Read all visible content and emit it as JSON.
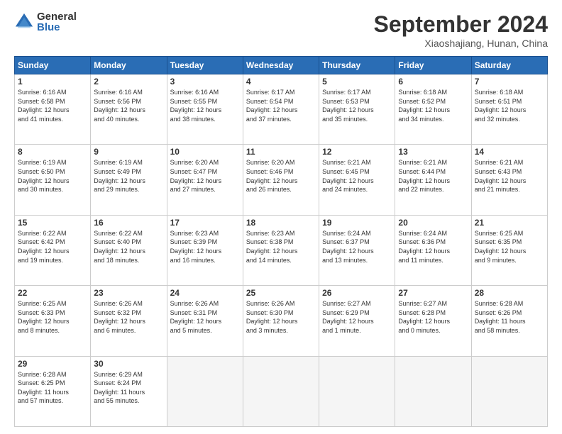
{
  "logo": {
    "general": "General",
    "blue": "Blue"
  },
  "title": "September 2024",
  "subtitle": "Xiaoshajiang, Hunan, China",
  "weekdays": [
    "Sunday",
    "Monday",
    "Tuesday",
    "Wednesday",
    "Thursday",
    "Friday",
    "Saturday"
  ],
  "weeks": [
    [
      {
        "day": "1",
        "info": "Sunrise: 6:16 AM\nSunset: 6:58 PM\nDaylight: 12 hours\nand 41 minutes."
      },
      {
        "day": "2",
        "info": "Sunrise: 6:16 AM\nSunset: 6:56 PM\nDaylight: 12 hours\nand 40 minutes."
      },
      {
        "day": "3",
        "info": "Sunrise: 6:16 AM\nSunset: 6:55 PM\nDaylight: 12 hours\nand 38 minutes."
      },
      {
        "day": "4",
        "info": "Sunrise: 6:17 AM\nSunset: 6:54 PM\nDaylight: 12 hours\nand 37 minutes."
      },
      {
        "day": "5",
        "info": "Sunrise: 6:17 AM\nSunset: 6:53 PM\nDaylight: 12 hours\nand 35 minutes."
      },
      {
        "day": "6",
        "info": "Sunrise: 6:18 AM\nSunset: 6:52 PM\nDaylight: 12 hours\nand 34 minutes."
      },
      {
        "day": "7",
        "info": "Sunrise: 6:18 AM\nSunset: 6:51 PM\nDaylight: 12 hours\nand 32 minutes."
      }
    ],
    [
      {
        "day": "8",
        "info": "Sunrise: 6:19 AM\nSunset: 6:50 PM\nDaylight: 12 hours\nand 30 minutes."
      },
      {
        "day": "9",
        "info": "Sunrise: 6:19 AM\nSunset: 6:49 PM\nDaylight: 12 hours\nand 29 minutes."
      },
      {
        "day": "10",
        "info": "Sunrise: 6:20 AM\nSunset: 6:47 PM\nDaylight: 12 hours\nand 27 minutes."
      },
      {
        "day": "11",
        "info": "Sunrise: 6:20 AM\nSunset: 6:46 PM\nDaylight: 12 hours\nand 26 minutes."
      },
      {
        "day": "12",
        "info": "Sunrise: 6:21 AM\nSunset: 6:45 PM\nDaylight: 12 hours\nand 24 minutes."
      },
      {
        "day": "13",
        "info": "Sunrise: 6:21 AM\nSunset: 6:44 PM\nDaylight: 12 hours\nand 22 minutes."
      },
      {
        "day": "14",
        "info": "Sunrise: 6:21 AM\nSunset: 6:43 PM\nDaylight: 12 hours\nand 21 minutes."
      }
    ],
    [
      {
        "day": "15",
        "info": "Sunrise: 6:22 AM\nSunset: 6:42 PM\nDaylight: 12 hours\nand 19 minutes."
      },
      {
        "day": "16",
        "info": "Sunrise: 6:22 AM\nSunset: 6:40 PM\nDaylight: 12 hours\nand 18 minutes."
      },
      {
        "day": "17",
        "info": "Sunrise: 6:23 AM\nSunset: 6:39 PM\nDaylight: 12 hours\nand 16 minutes."
      },
      {
        "day": "18",
        "info": "Sunrise: 6:23 AM\nSunset: 6:38 PM\nDaylight: 12 hours\nand 14 minutes."
      },
      {
        "day": "19",
        "info": "Sunrise: 6:24 AM\nSunset: 6:37 PM\nDaylight: 12 hours\nand 13 minutes."
      },
      {
        "day": "20",
        "info": "Sunrise: 6:24 AM\nSunset: 6:36 PM\nDaylight: 12 hours\nand 11 minutes."
      },
      {
        "day": "21",
        "info": "Sunrise: 6:25 AM\nSunset: 6:35 PM\nDaylight: 12 hours\nand 9 minutes."
      }
    ],
    [
      {
        "day": "22",
        "info": "Sunrise: 6:25 AM\nSunset: 6:33 PM\nDaylight: 12 hours\nand 8 minutes."
      },
      {
        "day": "23",
        "info": "Sunrise: 6:26 AM\nSunset: 6:32 PM\nDaylight: 12 hours\nand 6 minutes."
      },
      {
        "day": "24",
        "info": "Sunrise: 6:26 AM\nSunset: 6:31 PM\nDaylight: 12 hours\nand 5 minutes."
      },
      {
        "day": "25",
        "info": "Sunrise: 6:26 AM\nSunset: 6:30 PM\nDaylight: 12 hours\nand 3 minutes."
      },
      {
        "day": "26",
        "info": "Sunrise: 6:27 AM\nSunset: 6:29 PM\nDaylight: 12 hours\nand 1 minute."
      },
      {
        "day": "27",
        "info": "Sunrise: 6:27 AM\nSunset: 6:28 PM\nDaylight: 12 hours\nand 0 minutes."
      },
      {
        "day": "28",
        "info": "Sunrise: 6:28 AM\nSunset: 6:26 PM\nDaylight: 11 hours\nand 58 minutes."
      }
    ],
    [
      {
        "day": "29",
        "info": "Sunrise: 6:28 AM\nSunset: 6:25 PM\nDaylight: 11 hours\nand 57 minutes."
      },
      {
        "day": "30",
        "info": "Sunrise: 6:29 AM\nSunset: 6:24 PM\nDaylight: 11 hours\nand 55 minutes."
      },
      {
        "day": "",
        "info": ""
      },
      {
        "day": "",
        "info": ""
      },
      {
        "day": "",
        "info": ""
      },
      {
        "day": "",
        "info": ""
      },
      {
        "day": "",
        "info": ""
      }
    ]
  ]
}
